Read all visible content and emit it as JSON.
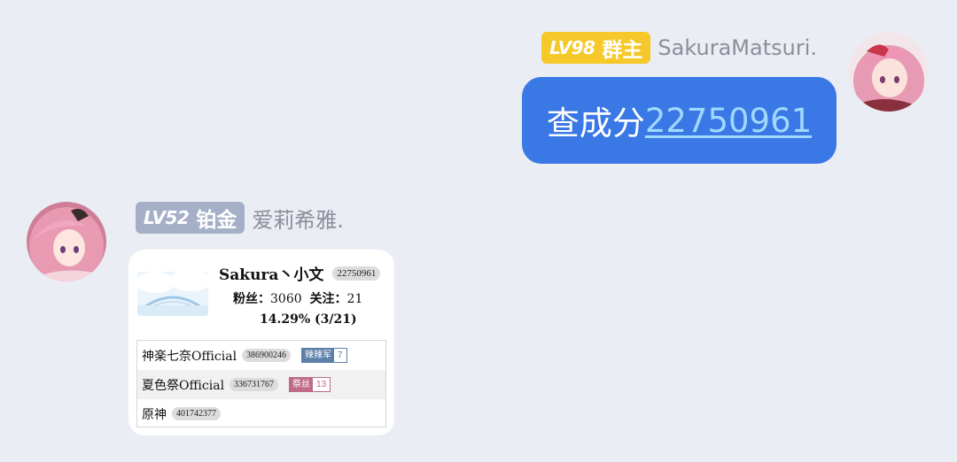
{
  "outgoing": {
    "level_badge": "LV98",
    "role_badge": "群主",
    "sender_name": "SakuraMatsuri.",
    "message_prefix": "查成分",
    "message_link": "22750961",
    "badge_color": "#f6c829",
    "bubble_color": "#3a78e6"
  },
  "incoming": {
    "level_badge": "LV52",
    "role_badge": "铂金",
    "sender_name": "爱莉希雅.",
    "badge_color": "#a5b0c8",
    "card": {
      "user_name": "Sakura丶小文",
      "uid": "22750961",
      "fans_label": "粉丝：",
      "fans_value": "3060",
      "follow_label": "关注：",
      "follow_value": "21",
      "percent": "14.29% (3/21)",
      "rows": [
        {
          "name": "神楽七奈Official",
          "uid": "386900246",
          "medal_name": "辣辣军",
          "medal_level": "7",
          "medal_color": "#5d7fa8"
        },
        {
          "name": "夏色祭Official",
          "uid": "336731767",
          "medal_name": "祭丝",
          "medal_level": "13",
          "medal_color": "#bf6a86"
        },
        {
          "name": "原神",
          "uid": "401742377"
        }
      ]
    }
  }
}
